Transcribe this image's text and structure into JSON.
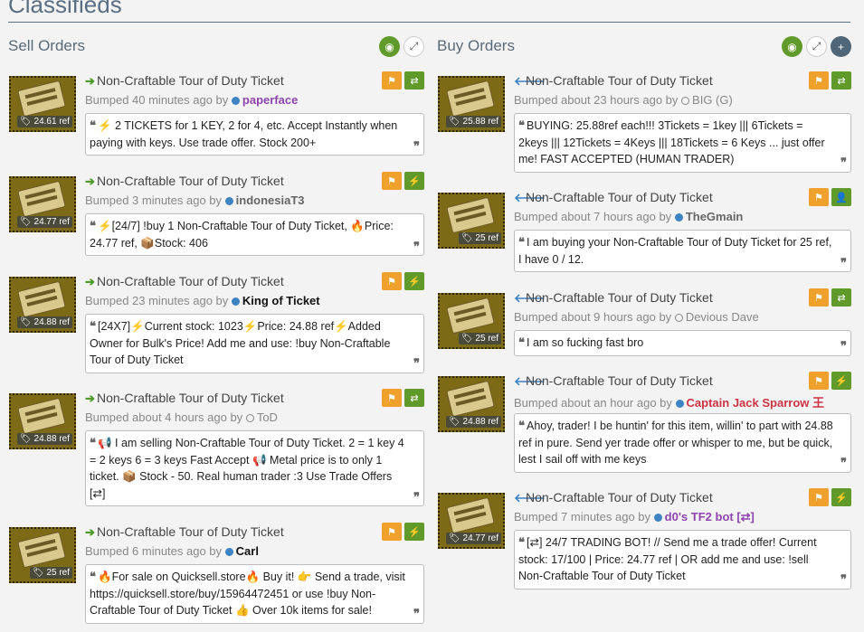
{
  "page": {
    "title": "Classifieds"
  },
  "sell": {
    "heading": "Sell Orders",
    "listings": [
      {
        "name": "Non-Craftable Tour of Duty Ticket",
        "price": "24.61 ref",
        "bumped": "Bumped 40 minutes ago by",
        "user": "paperface",
        "user_style": "purple",
        "online": true,
        "action": "trade",
        "quote": "⚡ 2 TICKETS for 1 KEY, 2 for 4, etc. Accept Instantly when paying with keys. Use trade offer. Stock 200+"
      },
      {
        "name": "Non-Craftable Tour of Duty Ticket",
        "price": "24.77 ref",
        "bumped": "Bumped 3 minutes ago by",
        "user": "indonesiaT3",
        "user_style": "normal",
        "online": true,
        "action": "bolt",
        "quote": "⚡[24/7] !buy 1 Non-Craftable Tour of Duty Ticket, 🔥Price: 24.77 ref, 📦Stock: 406"
      },
      {
        "name": "Non-Craftable Tour of Duty Ticket",
        "price": "24.88 ref",
        "bumped": "Bumped 23 minutes ago by",
        "user": "King of Ticket",
        "user_style": "black",
        "online": true,
        "action": "bolt",
        "quote": "[24X7]⚡Current stock: 1023⚡Price: 24.88 ref⚡Added Owner for Bulk's Price! Add me and use: !buy Non-Craftable Tour of Duty Ticket"
      },
      {
        "name": "Non-Craftable Tour of Duty Ticket",
        "price": "24.88 ref",
        "bumped": "Bumped about 4 hours ago by",
        "user": "ToD",
        "user_style": "grey",
        "online": false,
        "action": "trade",
        "quote": "📢 I am selling Non-Craftable Tour of Duty Ticket. 2 = 1 key 4 = 2 keys 6 = 3 keys Fast Accept 📢 Metal price is to only 1 ticket. 📦 Stock - 50. Real human trader :3 Use Trade Offers [⇄]"
      },
      {
        "name": "Non-Craftable Tour of Duty Ticket",
        "price": "25 ref",
        "bumped": "Bumped 6 minutes ago by",
        "user": "Carl",
        "user_style": "black",
        "online": true,
        "action": "bolt",
        "quote": "🔥For sale on Quicksell.store🔥 Buy it! 👉 Send a trade, visit https://quicksell.store/buy/15964472451 or use !buy Non-Craftable Tour of Duty Ticket 👍 Over 10k items for sale!"
      }
    ]
  },
  "buy": {
    "heading": "Buy Orders",
    "listings": [
      {
        "name": "Non-Craftable Tour of Duty Ticket",
        "price": "25.88 ref",
        "bumped": "Bumped about 23 hours ago by",
        "user": "BIG (G)",
        "user_style": "grey",
        "online": false,
        "action": "trade",
        "quote": "BUYING: 25.88ref each!!! 3Tickets = 1key ||| 6Tickets = 2keys ||| 12Tickets = 4Keys ||| 18Tickets = 6 Keys ... just offer me! FAST ACCEPTED (HUMAN TRADER)"
      },
      {
        "name": "Non-Craftable Tour of Duty Ticket",
        "price": "25 ref",
        "bumped": "Bumped about 7 hours ago by",
        "user": "TheGmain",
        "user_style": "normal",
        "online": true,
        "action": "adduser",
        "quote": "I am buying your Non-Craftable Tour of Duty Ticket for 25 ref, I have 0 / 12."
      },
      {
        "name": "Non-Craftable Tour of Duty Ticket",
        "price": "25 ref",
        "bumped": "Bumped about 9 hours ago by",
        "user": "Devious Dave",
        "user_style": "grey",
        "online": false,
        "action": "trade",
        "quote": "I am so fucking fast bro"
      },
      {
        "name": "Non-Craftable Tour of Duty Ticket",
        "price": "24.88 ref",
        "bumped": "Bumped about an hour ago by",
        "user": "Captain Jack Sparrow 王",
        "user_style": "red",
        "online": true,
        "action": "bolt",
        "quote": "Ahoy, trader! I be huntin' for this item, willin' to part with 24.88 ref in pure. Send yer trade offer or whisper to me, but be quick, lest I sail off with me keys"
      },
      {
        "name": "Non-Craftable Tour of Duty Ticket",
        "price": "24.77 ref",
        "bumped": "Bumped 7 minutes ago by",
        "user": "d0's TF2 bot [⇄]",
        "user_style": "purple",
        "online": true,
        "action": "bolt",
        "quote": "[⇄] 24/7 TRADING BOT! // Send me a trade offer! Current stock: 17/100 | Price: 24.77 ref | OR add me and use: !sell Non-Craftable Tour of Duty Ticket"
      }
    ]
  }
}
